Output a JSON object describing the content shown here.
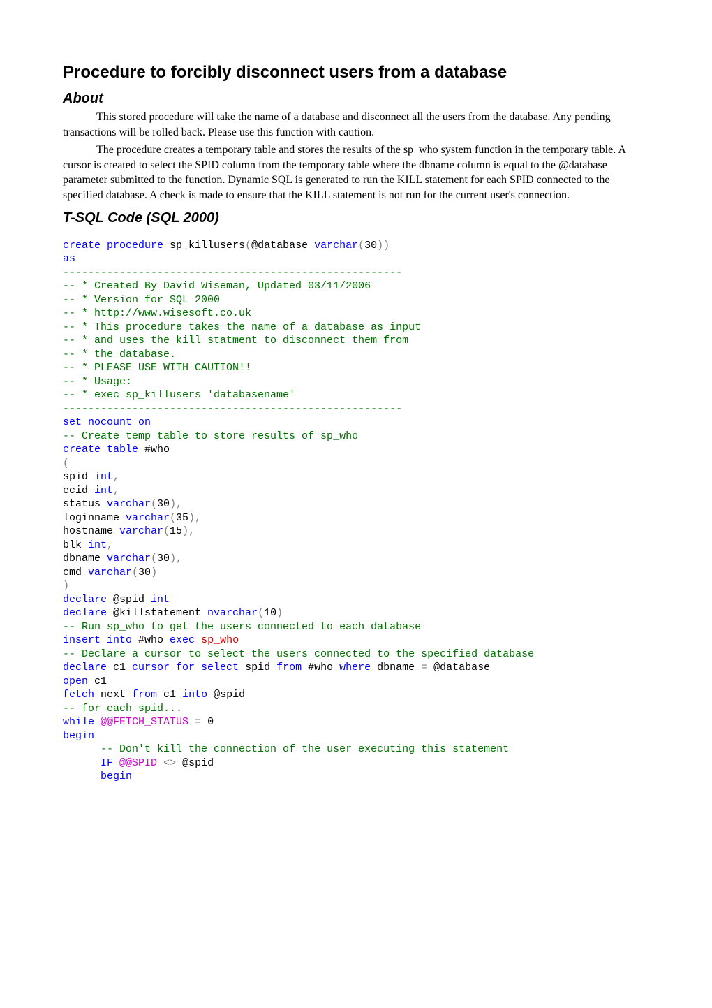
{
  "title": "Procedure to forcibly disconnect users from a database",
  "sections": {
    "about": {
      "heading": "About",
      "para1": "This stored procedure will take the name of a database and disconnect all the users from the database.  Any pending transactions will be rolled back.  Please use this function with caution.",
      "para2": "The procedure creates a temporary table and stores the results of the sp_who system function in the temporary table.  A cursor is created to select the SPID column from the temporary table where the dbname column is equal to the @database parameter submitted to the function. Dynamic SQL is generated to run the KILL statement for each SPID connected to the specified database.  A check is made to ensure that the KILL statement is not run for the current user's connection."
    },
    "tsql": {
      "heading": "T-SQL Code (SQL 2000)"
    }
  },
  "code_tokens": [
    {
      "t": "create procedure",
      "c": "kw"
    },
    {
      "t": " sp_killusers"
    },
    {
      "t": "(",
      "c": "gy"
    },
    {
      "t": "@database "
    },
    {
      "t": "varchar",
      "c": "kw"
    },
    {
      "t": "(",
      "c": "gy"
    },
    {
      "t": "30"
    },
    {
      "t": "))",
      "c": "gy"
    },
    {
      "t": "\n"
    },
    {
      "t": "as",
      "c": "kw"
    },
    {
      "t": "\n"
    },
    {
      "t": "------------------------------------------------------",
      "c": "cm"
    },
    {
      "t": "\n"
    },
    {
      "t": "-- * Created By David Wiseman, Updated 03/11/2006",
      "c": "cm"
    },
    {
      "t": "\n"
    },
    {
      "t": "-- * Version for SQL 2000",
      "c": "cm"
    },
    {
      "t": "\n"
    },
    {
      "t": "-- * http://www.wisesoft.co.uk",
      "c": "cm"
    },
    {
      "t": "\n"
    },
    {
      "t": "-- * This procedure takes the name of a database as input",
      "c": "cm"
    },
    {
      "t": "\n"
    },
    {
      "t": "-- * and uses the kill statment to disconnect them from",
      "c": "cm"
    },
    {
      "t": "\n"
    },
    {
      "t": "-- * the database.",
      "c": "cm"
    },
    {
      "t": "\n"
    },
    {
      "t": "-- * PLEASE USE WITH CAUTION!!",
      "c": "cm"
    },
    {
      "t": "\n"
    },
    {
      "t": "-- * Usage:",
      "c": "cm"
    },
    {
      "t": "\n"
    },
    {
      "t": "-- * exec sp_killusers 'databasename'",
      "c": "cm"
    },
    {
      "t": "\n"
    },
    {
      "t": "------------------------------------------------------",
      "c": "cm"
    },
    {
      "t": "\n"
    },
    {
      "t": "set nocount on",
      "c": "kw"
    },
    {
      "t": "\n"
    },
    {
      "t": "-- Create temp table to store results of sp_who",
      "c": "cm"
    },
    {
      "t": "\n"
    },
    {
      "t": "create table",
      "c": "kw"
    },
    {
      "t": " #who"
    },
    {
      "t": "\n"
    },
    {
      "t": "(",
      "c": "gy"
    },
    {
      "t": "\n"
    },
    {
      "t": "spid "
    },
    {
      "t": "int",
      "c": "kw"
    },
    {
      "t": ",",
      "c": "gy"
    },
    {
      "t": "\n"
    },
    {
      "t": "ecid "
    },
    {
      "t": "int",
      "c": "kw"
    },
    {
      "t": ",",
      "c": "gy"
    },
    {
      "t": "\n"
    },
    {
      "t": "status "
    },
    {
      "t": "varchar",
      "c": "kw"
    },
    {
      "t": "(",
      "c": "gy"
    },
    {
      "t": "30"
    },
    {
      "t": "),",
      "c": "gy"
    },
    {
      "t": "\n"
    },
    {
      "t": "loginname "
    },
    {
      "t": "varchar",
      "c": "kw"
    },
    {
      "t": "(",
      "c": "gy"
    },
    {
      "t": "35"
    },
    {
      "t": "),",
      "c": "gy"
    },
    {
      "t": "\n"
    },
    {
      "t": "hostname "
    },
    {
      "t": "varchar",
      "c": "kw"
    },
    {
      "t": "(",
      "c": "gy"
    },
    {
      "t": "15"
    },
    {
      "t": "),",
      "c": "gy"
    },
    {
      "t": "\n"
    },
    {
      "t": "blk "
    },
    {
      "t": "int",
      "c": "kw"
    },
    {
      "t": ",",
      "c": "gy"
    },
    {
      "t": "\n"
    },
    {
      "t": "dbname "
    },
    {
      "t": "varchar",
      "c": "kw"
    },
    {
      "t": "(",
      "c": "gy"
    },
    {
      "t": "30"
    },
    {
      "t": "),",
      "c": "gy"
    },
    {
      "t": "\n"
    },
    {
      "t": "cmd "
    },
    {
      "t": "varchar",
      "c": "kw"
    },
    {
      "t": "(",
      "c": "gy"
    },
    {
      "t": "30"
    },
    {
      "t": ")",
      "c": "gy"
    },
    {
      "t": "\n"
    },
    {
      "t": ")",
      "c": "gy"
    },
    {
      "t": "\n"
    },
    {
      "t": "declare",
      "c": "kw"
    },
    {
      "t": " @spid "
    },
    {
      "t": "int",
      "c": "kw"
    },
    {
      "t": "\n"
    },
    {
      "t": "declare",
      "c": "kw"
    },
    {
      "t": " @killstatement "
    },
    {
      "t": "nvarchar",
      "c": "kw"
    },
    {
      "t": "(",
      "c": "gy"
    },
    {
      "t": "10"
    },
    {
      "t": ")",
      "c": "gy"
    },
    {
      "t": "\n"
    },
    {
      "t": "-- Run sp_who to get the users connected to each database",
      "c": "cm"
    },
    {
      "t": "\n"
    },
    {
      "t": "insert into",
      "c": "kw"
    },
    {
      "t": " #who "
    },
    {
      "t": "exec",
      "c": "kw"
    },
    {
      "t": " sp_who",
      "c": "st"
    },
    {
      "t": "\n"
    },
    {
      "t": "-- Declare a cursor to select the users connected to the specified database",
      "c": "cm"
    },
    {
      "t": "\n"
    },
    {
      "t": "declare",
      "c": "kw"
    },
    {
      "t": " c1 "
    },
    {
      "t": "cursor for select",
      "c": "kw"
    },
    {
      "t": " spid "
    },
    {
      "t": "from",
      "c": "kw"
    },
    {
      "t": " #who "
    },
    {
      "t": "where",
      "c": "kw"
    },
    {
      "t": " dbname "
    },
    {
      "t": "=",
      "c": "gy"
    },
    {
      "t": " @database"
    },
    {
      "t": "\n"
    },
    {
      "t": "open",
      "c": "kw"
    },
    {
      "t": " c1"
    },
    {
      "t": "\n"
    },
    {
      "t": "fetch",
      "c": "kw"
    },
    {
      "t": " next "
    },
    {
      "t": "from",
      "c": "kw"
    },
    {
      "t": " c1 "
    },
    {
      "t": "into",
      "c": "kw"
    },
    {
      "t": " @spid"
    },
    {
      "t": "\n"
    },
    {
      "t": "-- for each spid...",
      "c": "cm"
    },
    {
      "t": "\n"
    },
    {
      "t": "while",
      "c": "kw"
    },
    {
      "t": " "
    },
    {
      "t": "@@FETCH_STATUS",
      "c": "fn"
    },
    {
      "t": " "
    },
    {
      "t": "=",
      "c": "gy"
    },
    {
      "t": " 0"
    },
    {
      "t": "\n"
    },
    {
      "t": "begin",
      "c": "kw"
    },
    {
      "t": "\n"
    },
    {
      "t": "      "
    },
    {
      "t": "-- Don't kill the connection of the user executing this statement",
      "c": "cm"
    },
    {
      "t": "\n"
    },
    {
      "t": "      "
    },
    {
      "t": "IF",
      "c": "kw"
    },
    {
      "t": " "
    },
    {
      "t": "@@SPID",
      "c": "fn"
    },
    {
      "t": " "
    },
    {
      "t": "<>",
      "c": "gy"
    },
    {
      "t": " @spid"
    },
    {
      "t": "\n"
    },
    {
      "t": "      "
    },
    {
      "t": "begin",
      "c": "kw"
    }
  ]
}
